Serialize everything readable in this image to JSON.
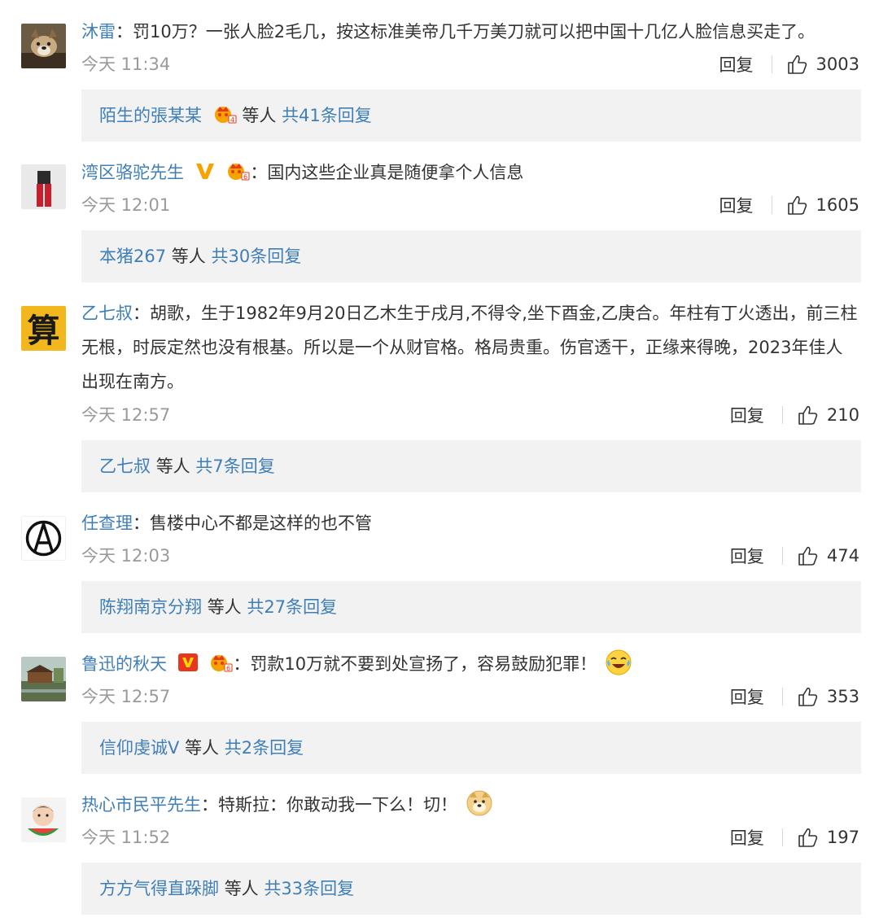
{
  "comments": [
    {
      "user": "沐雷",
      "text": "罚10万？一张人脸2毛几，按这标准美帝几千万美刀就可以把中国十几亿人脸信息买走了。",
      "time": "今天 11:34",
      "reply_label": "回复",
      "likes": "3003",
      "summary_user": "陌生的張某某",
      "summary_mid": "等人",
      "summary_total": "共41条回复"
    },
    {
      "user": "湾区骆驼先生",
      "text": "国内这些企业真是随便拿个人信息",
      "time": "今天 12:01",
      "reply_label": "回复",
      "likes": "1605",
      "summary_user": "本猪267",
      "summary_mid": "等人",
      "summary_total": "共30条回复"
    },
    {
      "user": "乙七叔",
      "text": "胡歌，生于1982年9月20日乙木生于戌月,不得令,坐下酉金,乙庚合。年柱有丁火透出，前三柱无根，时辰定然也没有根基。所以是一个从财官格。格局贵重。伤官透干，正缘来得晚，2023年佳人出现在南方。",
      "time": "今天 12:57",
      "reply_label": "回复",
      "likes": "210",
      "summary_user": "乙七叔",
      "summary_mid": "等人",
      "summary_total": "共7条回复"
    },
    {
      "user": "任查理",
      "text": "售楼中心不都是这样的也不管",
      "time": "今天 12:03",
      "reply_label": "回复",
      "likes": "474",
      "summary_user": "陈翔南京分翔",
      "summary_mid": "等人",
      "summary_total": "共27条回复"
    },
    {
      "user": "鲁迅的秋天",
      "text": "罚款10万就不要到处宣扬了，容易鼓励犯罪！",
      "time": "今天 12:57",
      "reply_label": "回复",
      "likes": "353",
      "summary_user": "信仰虔诚V",
      "summary_mid": "等人",
      "summary_total": "共2条回复"
    },
    {
      "user": "热心市民平先生",
      "text": "特斯拉：你敢动我一下么！切！",
      "time": "今天 11:52",
      "reply_label": "回复",
      "likes": "197",
      "summary_user": "方方气得直跺脚",
      "summary_mid": "等人",
      "summary_total": "共33条回复"
    }
  ],
  "colon": "：",
  "avatar_glyph_3": "算",
  "colors": {
    "username": "#3f7fb8",
    "time": "#9a9a9a",
    "summary_bg": "#f2f2f2",
    "vip_orange": "#f4a300",
    "vip_red": "#e8371c"
  },
  "icons": [
    "thumbs-up-icon",
    "crown-badge-icon",
    "verified-v-icon",
    "laughing-tears-emoji",
    "doge-emoji"
  ]
}
